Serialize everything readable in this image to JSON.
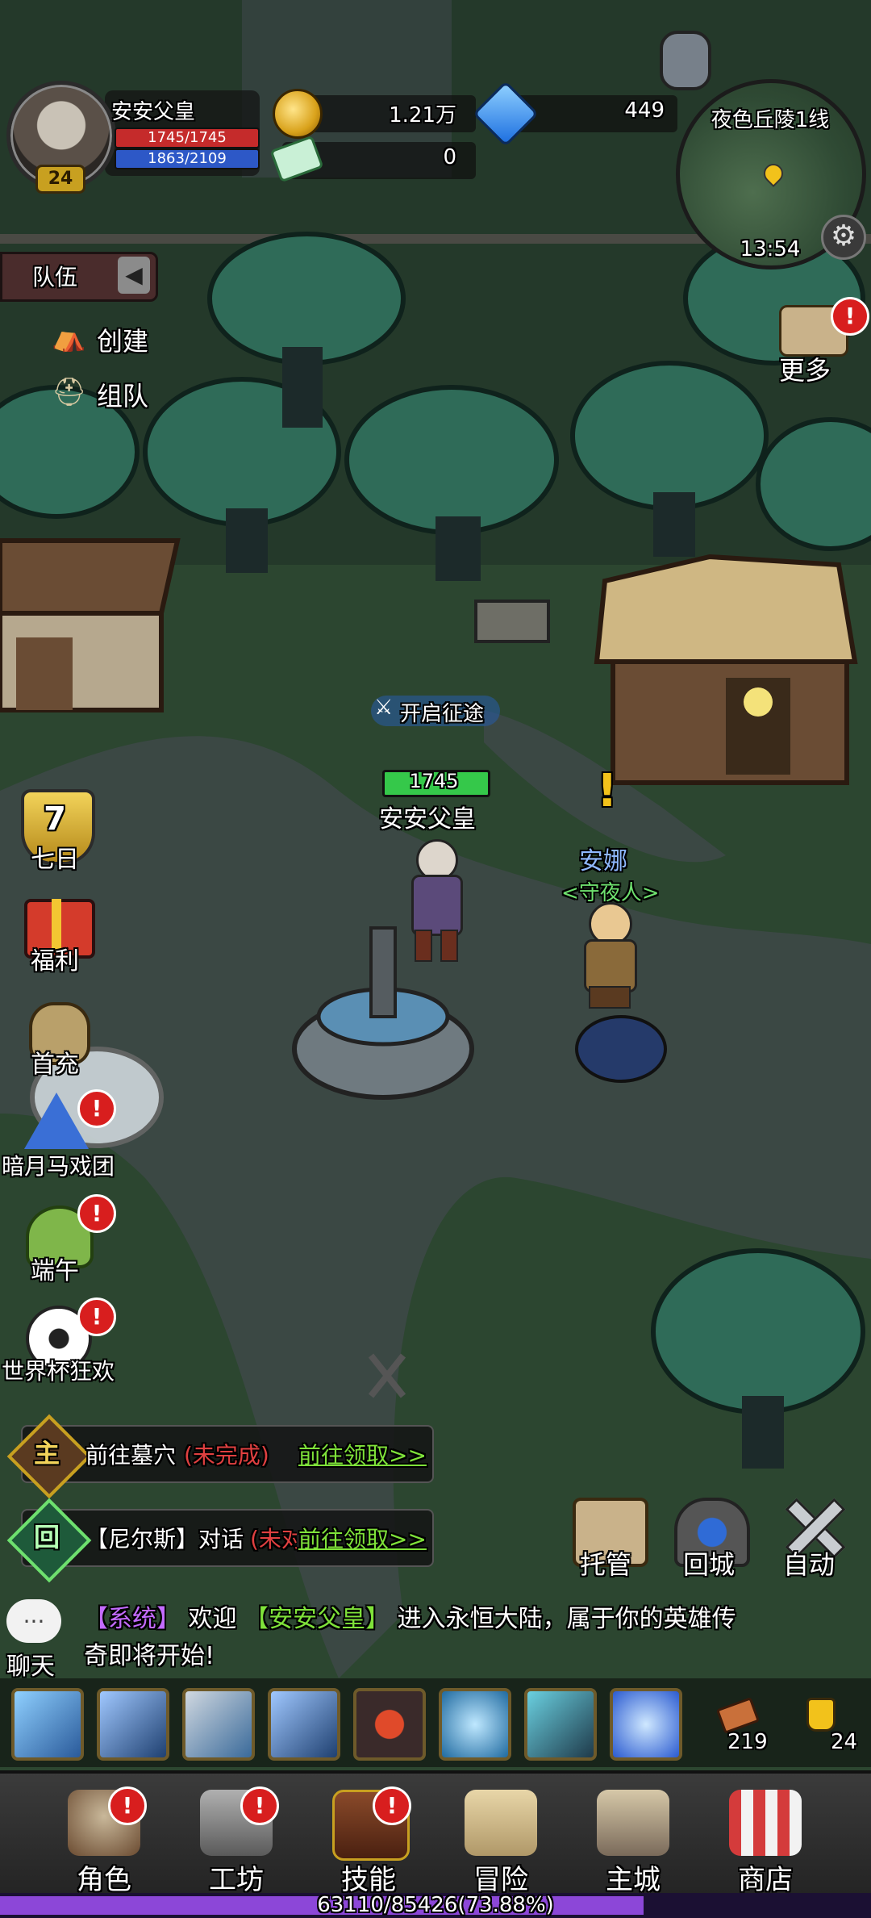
{
  "player": {
    "name": "安安父皇",
    "level": "24",
    "hp_text": "1745/1745",
    "mp_text": "1863/2109",
    "hp_fraction": 1.0,
    "mp_fraction": 0.883
  },
  "currency": {
    "gold": "1.21万",
    "diamond": "449",
    "ticket": "0"
  },
  "minimap": {
    "map_name": "夜色丘陵1线",
    "time": "13:54"
  },
  "team": {
    "tab_label": "队伍",
    "create_label": "创建",
    "join_label": "组队"
  },
  "more_label": "更多",
  "activities": [
    {
      "label": "七日",
      "icon": "seven-day-shield-icon",
      "number": "7"
    },
    {
      "label": "福利",
      "icon": "gift-box-icon"
    },
    {
      "label": "首充",
      "icon": "coin-bag-icon"
    },
    {
      "label": "暗月马戏团",
      "icon": "circus-tent-icon"
    },
    {
      "label": "端午",
      "icon": "zongzi-icon"
    },
    {
      "label": "世界杯狂欢",
      "icon": "soccer-ball-icon"
    }
  ],
  "world": {
    "expedition_label": "开启征途",
    "player_hp": "1745",
    "player_name": "安安父皇",
    "npc_name": "安娜",
    "npc_title": "<守夜人>",
    "npc_mark": "!"
  },
  "quests": [
    {
      "type": "主",
      "text": "前往墓穴",
      "status": "(未完成)",
      "link": "前往领取>>"
    },
    {
      "type": "回",
      "text": "【尼尔斯】对话",
      "status": "(未对",
      "link": "前往领取>>"
    }
  ],
  "actions": {
    "auto_manage": "托管",
    "return_city": "回城",
    "auto": "自动"
  },
  "chat": {
    "label": "聊天",
    "bubble": "...",
    "system_tag": "【系统】",
    "msg_a": "欢迎",
    "msg_name": "【安安父皇】",
    "msg_b": "进入永恒大陆，属于你的英雄传",
    "msg_c": "奇即将开始!"
  },
  "inventory": {
    "item1_count": "219",
    "item2_count": "24"
  },
  "skills": [
    {
      "icon": "spear-skill-icon"
    },
    {
      "icon": "pierce-skill-icon"
    },
    {
      "icon": "whistle-skill-icon"
    },
    {
      "icon": "pierce-skill-icon"
    },
    {
      "icon": "target-skill-icon"
    },
    {
      "icon": "whirlwind-skill-icon"
    },
    {
      "icon": "chain-skill-icon"
    },
    {
      "icon": "ice-shield-skill-icon"
    }
  ],
  "nav": [
    {
      "label": "角色",
      "icon": "character-icon",
      "alert": true
    },
    {
      "label": "工坊",
      "icon": "anvil-icon",
      "alert": true
    },
    {
      "label": "技能",
      "icon": "skill-book-icon",
      "alert": true
    },
    {
      "label": "冒险",
      "icon": "adventure-map-icon",
      "alert": false
    },
    {
      "label": "主城",
      "icon": "castle-icon",
      "alert": false
    },
    {
      "label": "商店",
      "icon": "shop-stall-icon",
      "alert": false
    }
  ],
  "experience": {
    "text": "63110/85426(73.88%)",
    "fraction": 0.7388
  },
  "colors": {
    "hp": "#c52b2b",
    "mp": "#2d58c7",
    "quest_link": "#7fe23a",
    "quest_status": "#e04040",
    "npc_name": "#8fb8ff",
    "npc_title": "#6ee06e",
    "system": "#c36bff",
    "xp": "#8c47d8"
  }
}
